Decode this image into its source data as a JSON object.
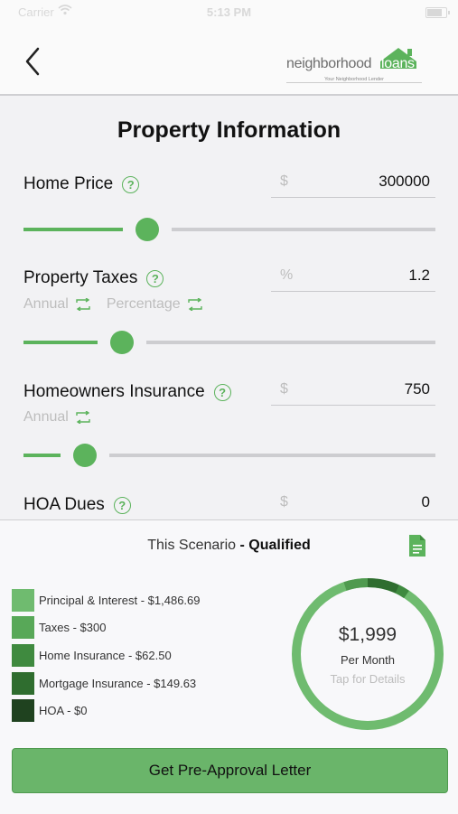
{
  "status_bar": {
    "carrier": "Carrier",
    "time": "5:13 PM"
  },
  "header": {
    "back_icon": "chevron-left-icon",
    "logo": {
      "part1": "neighborhood",
      "part2": "loans",
      "tagline": "Your Neighborhood Lender"
    }
  },
  "page": {
    "title": "Property Information"
  },
  "fields": {
    "home_price": {
      "label": "Home Price",
      "unit": "$",
      "value": "300000",
      "slider_level": 0.3
    },
    "property_taxes": {
      "label": "Property Taxes",
      "unit": "%",
      "value": "1.2",
      "toggle1": "Annual",
      "toggle2": "Percentage",
      "slider_level": 0.24
    },
    "homeowners_insurance": {
      "label": "Homeowners Insurance",
      "unit": "$",
      "value": "750",
      "toggle1": "Annual",
      "slider_level": 0.15
    },
    "hoa_dues": {
      "label": "HOA Dues",
      "unit": "$",
      "value": "0"
    }
  },
  "summary": {
    "scenario_prefix": "This Scenario",
    "scenario_status": "- Qualified",
    "legend": [
      {
        "label": "Principal & Interest - $1,486.69",
        "color": "#6fbb6f"
      },
      {
        "label": "Taxes - $300",
        "color": "#58a858"
      },
      {
        "label": "Home Insurance - $62.50",
        "color": "#3f8a3f"
      },
      {
        "label": "Mortgage Insurance - $149.63",
        "color": "#2f6d2f"
      },
      {
        "label": "HOA - $0",
        "color": "#1f421f"
      }
    ],
    "total": "$1,999",
    "per_month": "Per Month",
    "tap_hint": "Tap for Details"
  },
  "cta": {
    "label": "Get Pre-Approval Letter"
  },
  "colors": {
    "accent": "#5cb35c",
    "track": "#cdcdd0",
    "muted_text": "#bdbdbd"
  }
}
